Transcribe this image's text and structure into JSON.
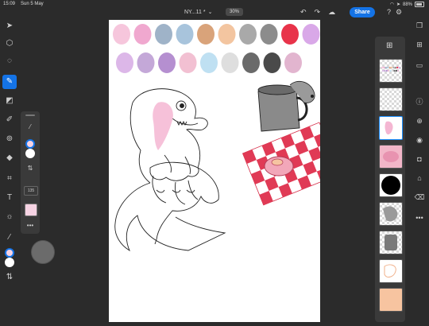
{
  "status": {
    "time": "15:09",
    "date": "Sun 5 May",
    "battery": "88%"
  },
  "document": {
    "title": "NY...11 *",
    "zoom": "30%",
    "share_label": "Share"
  },
  "brush_panel": {
    "size_value": "135"
  },
  "palette": [
    "#f6c6dc",
    "#f0a8cf",
    "#9fb3c8",
    "#a8c4dc",
    "#d9a37a",
    "#f3c5a0",
    "#a9a9a9",
    "#8c8c8c",
    "#e8334a",
    "#d9a8e8",
    "#dcb7e8",
    "#c4a8d8",
    "#b58fd0",
    "#f2c0d2",
    "#bfe0f2",
    "#dedede",
    "#6a6a6a",
    "#4a4a4a",
    "#e2b5cf"
  ],
  "colors": {
    "accent": "#1473e6",
    "primary_swatch": "#f7d4e4",
    "secondary_swatch": "#ffffff"
  },
  "icons": {
    "left_toolbar": [
      "select-icon",
      "transform-icon",
      "lasso-icon",
      "brush-icon",
      "eraser-icon",
      "smudge-icon",
      "clone-icon",
      "fill-icon",
      "crop-icon",
      "text-icon",
      "adjust-icon",
      "eyedropper-icon",
      "color-swatch-icon",
      "swap-icon"
    ],
    "right_toolbar": [
      "layers-icon",
      "add-layer-icon",
      "comment-icon",
      "info-icon",
      "add-adjustment-icon",
      "visibility-icon",
      "mask-icon",
      "lock-icon",
      "clear-icon",
      "more-icon"
    ]
  }
}
